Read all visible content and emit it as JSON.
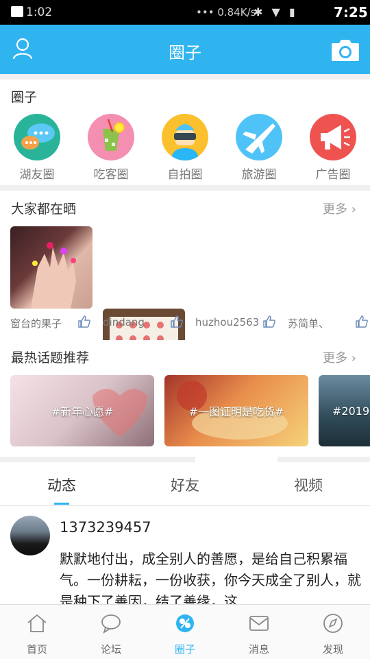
{
  "status_bar": {
    "time_left": "1:02",
    "network_speed": "0.84K/s",
    "time": "7:25"
  },
  "header": {
    "title": "圈子",
    "left_icon": "user-icon",
    "right_icon": "camera-icon",
    "color": "#2fb4f0"
  },
  "circles": {
    "title": "圈子",
    "items": [
      {
        "label": "湖友圈",
        "icon": "chat-bubbles-icon",
        "bg": "#29b49a"
      },
      {
        "label": "吃客圈",
        "icon": "drink-icon",
        "bg": "#f48fb1"
      },
      {
        "label": "自拍圈",
        "icon": "vr-person-icon",
        "bg": "#fbc02d"
      },
      {
        "label": "旅游圈",
        "icon": "airplane-icon",
        "bg": "#4fc3f7"
      },
      {
        "label": "广告圈",
        "icon": "megaphone-icon",
        "bg": "#ef5350"
      }
    ]
  },
  "shares": {
    "title": "大家都在晒",
    "more": "更多",
    "items": [
      {
        "name": "窗台的果子"
      },
      {
        "name": "dindang"
      },
      {
        "name": "huzhou2563"
      },
      {
        "name": "苏简单、"
      }
    ]
  },
  "topics": {
    "title": "最热话题推荐",
    "more": "更多",
    "items": [
      {
        "label": "#新年心愿#"
      },
      {
        "label": "#一图证明是吃货#"
      },
      {
        "label": "#2019"
      }
    ]
  },
  "tabs": {
    "items": [
      "动态",
      "好友",
      "视频"
    ],
    "active": "动态"
  },
  "post": {
    "user": "1373239457",
    "text": "默默地付出，成全别人的善愿，是给自己积累福气。一份耕耘，一份收获，你今天成全了别人，就是种下了善因，结了善缘，这"
  },
  "bottom_nav": {
    "items": [
      {
        "label": "首页",
        "icon": "home-icon"
      },
      {
        "label": "论坛",
        "icon": "forum-icon"
      },
      {
        "label": "圈子",
        "icon": "circle-icon"
      },
      {
        "label": "消息",
        "icon": "mail-icon"
      },
      {
        "label": "发现",
        "icon": "compass-icon"
      }
    ],
    "active": "圈子"
  }
}
